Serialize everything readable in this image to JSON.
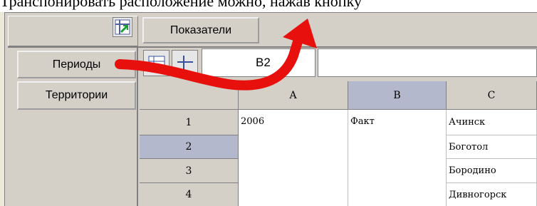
{
  "caption": "Транспонировать расположение можно, нажав кнопку",
  "toolbar": {
    "transpose_icon": "transpose-icon",
    "columns_button": "Показатели"
  },
  "rows_area": {
    "items": [
      {
        "label": "Периоды"
      },
      {
        "label": "Территории"
      }
    ]
  },
  "formula_bar": {
    "cell_reference": "B2",
    "value": ""
  },
  "grid": {
    "column_headers": [
      "A",
      "B",
      "C"
    ],
    "row_headers": [
      "1",
      "2",
      "3",
      "4"
    ],
    "selected_column": "B",
    "selected_row": "2",
    "cells": {
      "A1": "2006",
      "B1": "Факт",
      "C1": "Ачинск",
      "C2": "Боготол",
      "C3": "Бородино",
      "C4": "Дивногорск"
    }
  },
  "colors": {
    "arrow": "#e8100c",
    "selection": "#b4b8cc",
    "panel": "#d4d0c8"
  }
}
